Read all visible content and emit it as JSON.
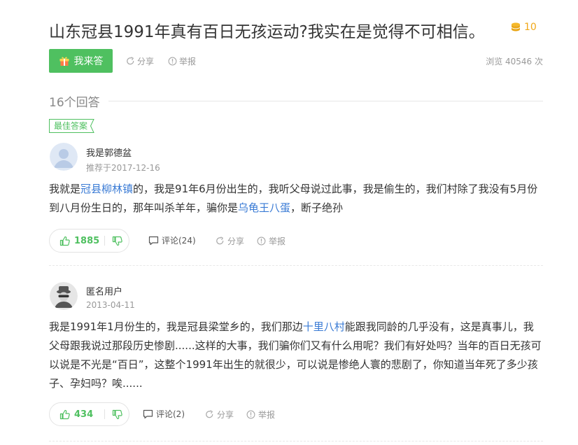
{
  "question": {
    "title": "山东冠县1991年真有百日无孩运动?我实在是觉得不可相信。",
    "reward": "10",
    "views_text": "浏览 40546 次"
  },
  "actions": {
    "answer_button": "我来答",
    "share": "分享",
    "report": "举报"
  },
  "answers_count": "16个回答",
  "best_badge": "最佳答案",
  "answers": [
    {
      "user": "我是郭德盆",
      "meta": "推荐于2017-12-16",
      "segments": [
        {
          "t": "我就是"
        },
        {
          "t": "冠县柳林镇",
          "link": true
        },
        {
          "t": "的，我是91年6月份出生的，我听父母说过此事，我是偷生的，我们村除了我没有5月份到八月份生日的，那年叫杀羊年，骗你是"
        },
        {
          "t": "乌龟王八蛋",
          "link": true
        },
        {
          "t": "，断子绝孙"
        }
      ],
      "likes": "1885",
      "comments": "评论(24)",
      "share": "分享",
      "report": "举报"
    },
    {
      "user": "匿名用户",
      "meta": "2013-04-11",
      "segments": [
        {
          "t": "我是1991年1月份生的，我是冠县梁堂乡的，我们那边"
        },
        {
          "t": "十里八村",
          "link": true
        },
        {
          "t": "能跟我同龄的几乎没有，这是真事儿，我父母跟我说过那段历史惨剧......这样的大事，我们骗你们又有什么用呢？我们有好处吗？当年的百日无孩可以说是不光是“百日”，这整个1991年出生的就很少，可以说是惨绝人寰的悲剧了，你知道当年死了多少孩子、孕妇吗？唉......"
        }
      ],
      "likes": "434",
      "comments": "评论(2)",
      "share": "分享",
      "report": "举报"
    }
  ],
  "colors": {
    "accent_green": "#4fc060",
    "link_blue": "#3a7bd5",
    "coin_gold": "#f0a818",
    "muted_gray": "#999999"
  },
  "icons": [
    "coin-icon",
    "gift-icon",
    "share-icon",
    "report-icon",
    "thumb-up-icon",
    "thumb-down-icon",
    "comment-icon",
    "avatar-default-icon",
    "avatar-anonymous-icon"
  ]
}
